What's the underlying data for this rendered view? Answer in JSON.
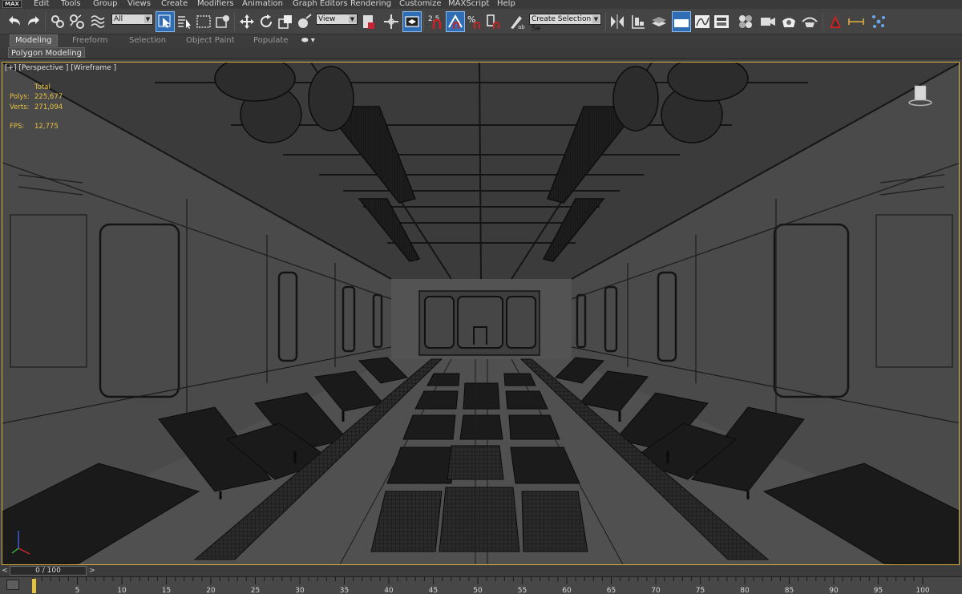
{
  "app": {
    "logo": "MAX",
    "menu": [
      "Edit",
      "Tools",
      "Group",
      "Views",
      "Create",
      "Modifiers",
      "Animation",
      "Graph Editors",
      "Rendering",
      "Customize",
      "MAXScript",
      "Help"
    ]
  },
  "toolbar": {
    "selection_filter": "All",
    "reference_coord": "View",
    "snap_label": "2.5",
    "named_selection_placeholder": "Create Selection Se",
    "icons": [
      "undo-icon",
      "redo-icon",
      "link-icon",
      "unlink-icon",
      "bind-space-warp-icon",
      "select-object-icon",
      "select-by-name-icon",
      "rect-region-icon",
      "window-crossing-icon",
      "move-icon",
      "rotate-icon",
      "scale-icon",
      "place-icon",
      "pivot-icon",
      "select-manipulate-icon",
      "snaps-toggle-icon",
      "angle-snap-icon",
      "percent-snap-icon",
      "spinner-snap-icon",
      "edit-named-sets-icon",
      "mirror-icon",
      "align-icon",
      "toggle-layer-explorer-icon",
      "toggle-ribbon-icon",
      "curve-editor-icon",
      "schematic-view-icon",
      "material-editor-icon",
      "render-setup-icon",
      "rendered-frame-window-icon",
      "render-icon",
      "a360-icon"
    ]
  },
  "ribbon": {
    "tabs": [
      "Modeling",
      "Freeform",
      "Selection",
      "Object Paint",
      "Populate"
    ],
    "active_tab": "Modeling",
    "panel_label": "Polygon Modeling"
  },
  "viewport": {
    "label": "[+] [Perspective ] [Wireframe ]",
    "stats": {
      "header": "Total",
      "polys_label": "Polys:",
      "polys": "225,677",
      "verts_label": "Verts:",
      "verts": "271,094",
      "fps_label": "FPS:",
      "fps": "12,775"
    },
    "border_color": "#d8b03a",
    "background_color": "#555555",
    "stats_color": "#e8c040"
  },
  "timeline": {
    "frame_display": "0 / 100",
    "prev_label": "<",
    "next_label": ">",
    "ticks": [
      "5",
      "10",
      "15",
      "20",
      "25",
      "30",
      "35",
      "40",
      "45",
      "50",
      "55",
      "60",
      "65",
      "70",
      "75",
      "80",
      "85",
      "90",
      "95",
      "100"
    ]
  }
}
